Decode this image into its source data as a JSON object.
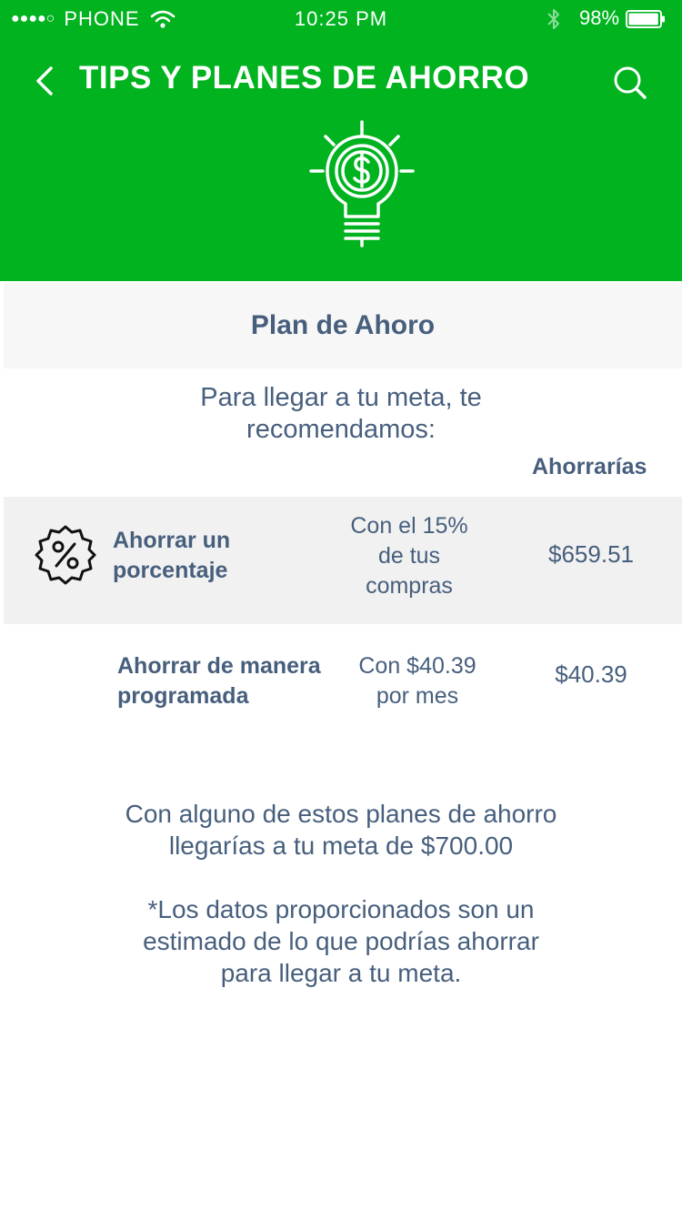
{
  "status_bar": {
    "signal_dots": "●●●●○",
    "carrier": "PHONE",
    "time": "10:25 PM",
    "battery_percent": "98%",
    "battery_level": 0.98
  },
  "nav": {
    "back_icon": "chevron-left-icon",
    "title": "TIPS Y PLANES DE AHORRO",
    "search_icon": "search-icon"
  },
  "hero_icon": "lightbulb-dollar-icon",
  "plan": {
    "title": "Plan de Ahoro",
    "intro_lines": [
      "Para llegar a tu meta, te",
      "recomendamos:"
    ],
    "column_header": "Ahorrarías",
    "rows": [
      {
        "icon": "percent-badge-icon",
        "name_lines": [
          "Ahorrar un",
          "porcentaje"
        ],
        "desc_lines": [
          "Con el 15%",
          "de tus",
          "compras"
        ],
        "amount": "$659.51"
      },
      {
        "name_lines": [
          "Ahorrar de manera",
          "programada"
        ],
        "desc_lines": [
          "Con $40.39",
          "por mes"
        ],
        "amount": "$40.39"
      }
    ],
    "summary_lines": [
      "Con alguno de estos planes de ahorro",
      "llegarías a tu meta de $700.00"
    ],
    "note_lines": [
      "*Los datos proporcionados son un",
      "estimado de lo que podrías ahorrar",
      "para llegar a tu meta."
    ]
  },
  "colors": {
    "header_green": "#00b31f",
    "text_slate": "#475f7d",
    "row_shade": "#f1f1f1"
  }
}
